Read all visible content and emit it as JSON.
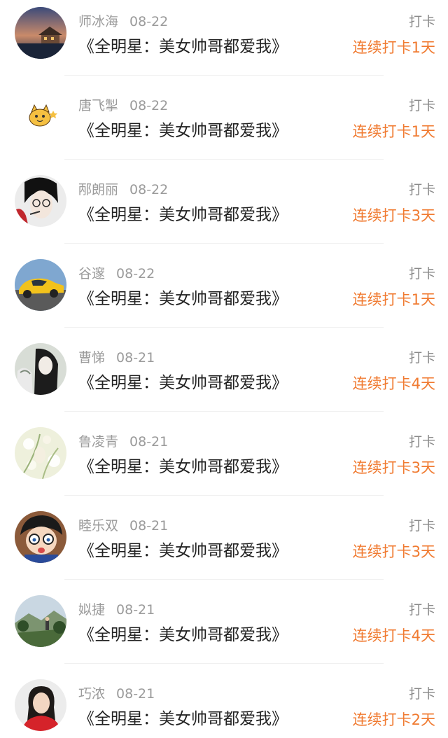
{
  "items": [
    {
      "name": "师冰海",
      "date": "08-22",
      "title": "《全明星：美女帅哥都爱我》",
      "type": "打卡",
      "streak": "连续打卡1天",
      "avatar_icon": "lake-house-photo-icon"
    },
    {
      "name": "唐飞掣",
      "date": "08-22",
      "title": "《全明星：美女帅哥都爱我》",
      "type": "打卡",
      "streak": "连续打卡1天",
      "avatar_icon": "cartoon-cat-icon"
    },
    {
      "name": "邴朗丽",
      "date": "08-22",
      "title": "《全明星：美女帅哥都爱我》",
      "type": "打卡",
      "streak": "连续打卡3天",
      "avatar_icon": "anime-boy-icon"
    },
    {
      "name": "谷邃",
      "date": "08-22",
      "title": "《全明星：美女帅哥都爱我》",
      "type": "打卡",
      "streak": "连续打卡1天",
      "avatar_icon": "yellow-car-icon"
    },
    {
      "name": "曹悌",
      "date": "08-21",
      "title": "《全明星：美女帅哥都爱我》",
      "type": "打卡",
      "streak": "连续打卡4天",
      "avatar_icon": "anime-couple-icon"
    },
    {
      "name": "鲁凌青",
      "date": "08-21",
      "title": "《全明星：美女帅哥都爱我》",
      "type": "打卡",
      "streak": "连续打卡3天",
      "avatar_icon": "flowers-photo-icon"
    },
    {
      "name": "睦乐双",
      "date": "08-21",
      "title": "《全明星：美女帅哥都爱我》",
      "type": "打卡",
      "streak": "连续打卡3天",
      "avatar_icon": "cartoon-detective-icon"
    },
    {
      "name": "姒捷",
      "date": "08-21",
      "title": "《全明星：美女帅哥都爱我》",
      "type": "打卡",
      "streak": "连续打卡4天",
      "avatar_icon": "mountain-person-icon"
    },
    {
      "name": "巧浓",
      "date": "08-21",
      "title": "《全明星：美女帅哥都爱我》",
      "type": "打卡",
      "streak": "连续打卡2天",
      "avatar_icon": "woman-portrait-icon"
    }
  ],
  "colors": {
    "streak": "#f07a30",
    "name": "#9b9b9b",
    "title": "#222222",
    "type": "#8a8a8a"
  }
}
